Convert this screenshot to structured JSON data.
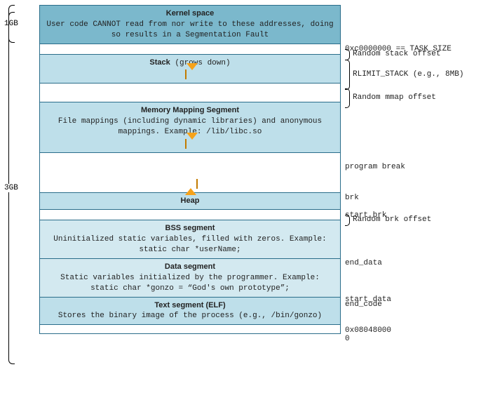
{
  "left": {
    "top_size": "1GB",
    "bottom_size": "3GB"
  },
  "segments": {
    "kernel": {
      "title": "Kernel space",
      "desc": "User code CANNOT read from nor write to these addresses, doing so results in a Segmentation Fault"
    },
    "stack": {
      "title": "Stack",
      "suffix": " (grows down)"
    },
    "mmap": {
      "title": "Memory Mapping Segment",
      "desc": "File mappings (including dynamic libraries) and anonymous mappings. Example: /lib/libc.so"
    },
    "heap": {
      "title": "Heap"
    },
    "bss": {
      "title": "BSS segment",
      "desc": "Uninitialized static variables, filled with zeros. Example: static char *userName;"
    },
    "data": {
      "title": "Data segment",
      "desc": "Static variables initialized by the programmer. Example: static char *gonzo = “God's own prototype”;"
    },
    "text": {
      "title": "Text segment (ELF)",
      "desc": "Stores the binary image of the process (e.g., /bin/gonzo)"
    }
  },
  "right": {
    "task_size": "0xc0000000 == TASK_SIZE",
    "rand_stack": "Random stack offset",
    "rlimit": "RLIMIT_STACK (e.g., 8MB)",
    "rand_mmap": "Random mmap offset",
    "program_break": "program break",
    "brk": "brk",
    "start_brk": "start_brk",
    "rand_brk": "Random brk offset",
    "end_data": "end_data",
    "start_data": "start_data",
    "end_code": "end_code",
    "text_base": "0x08048000",
    "zero": "0"
  }
}
